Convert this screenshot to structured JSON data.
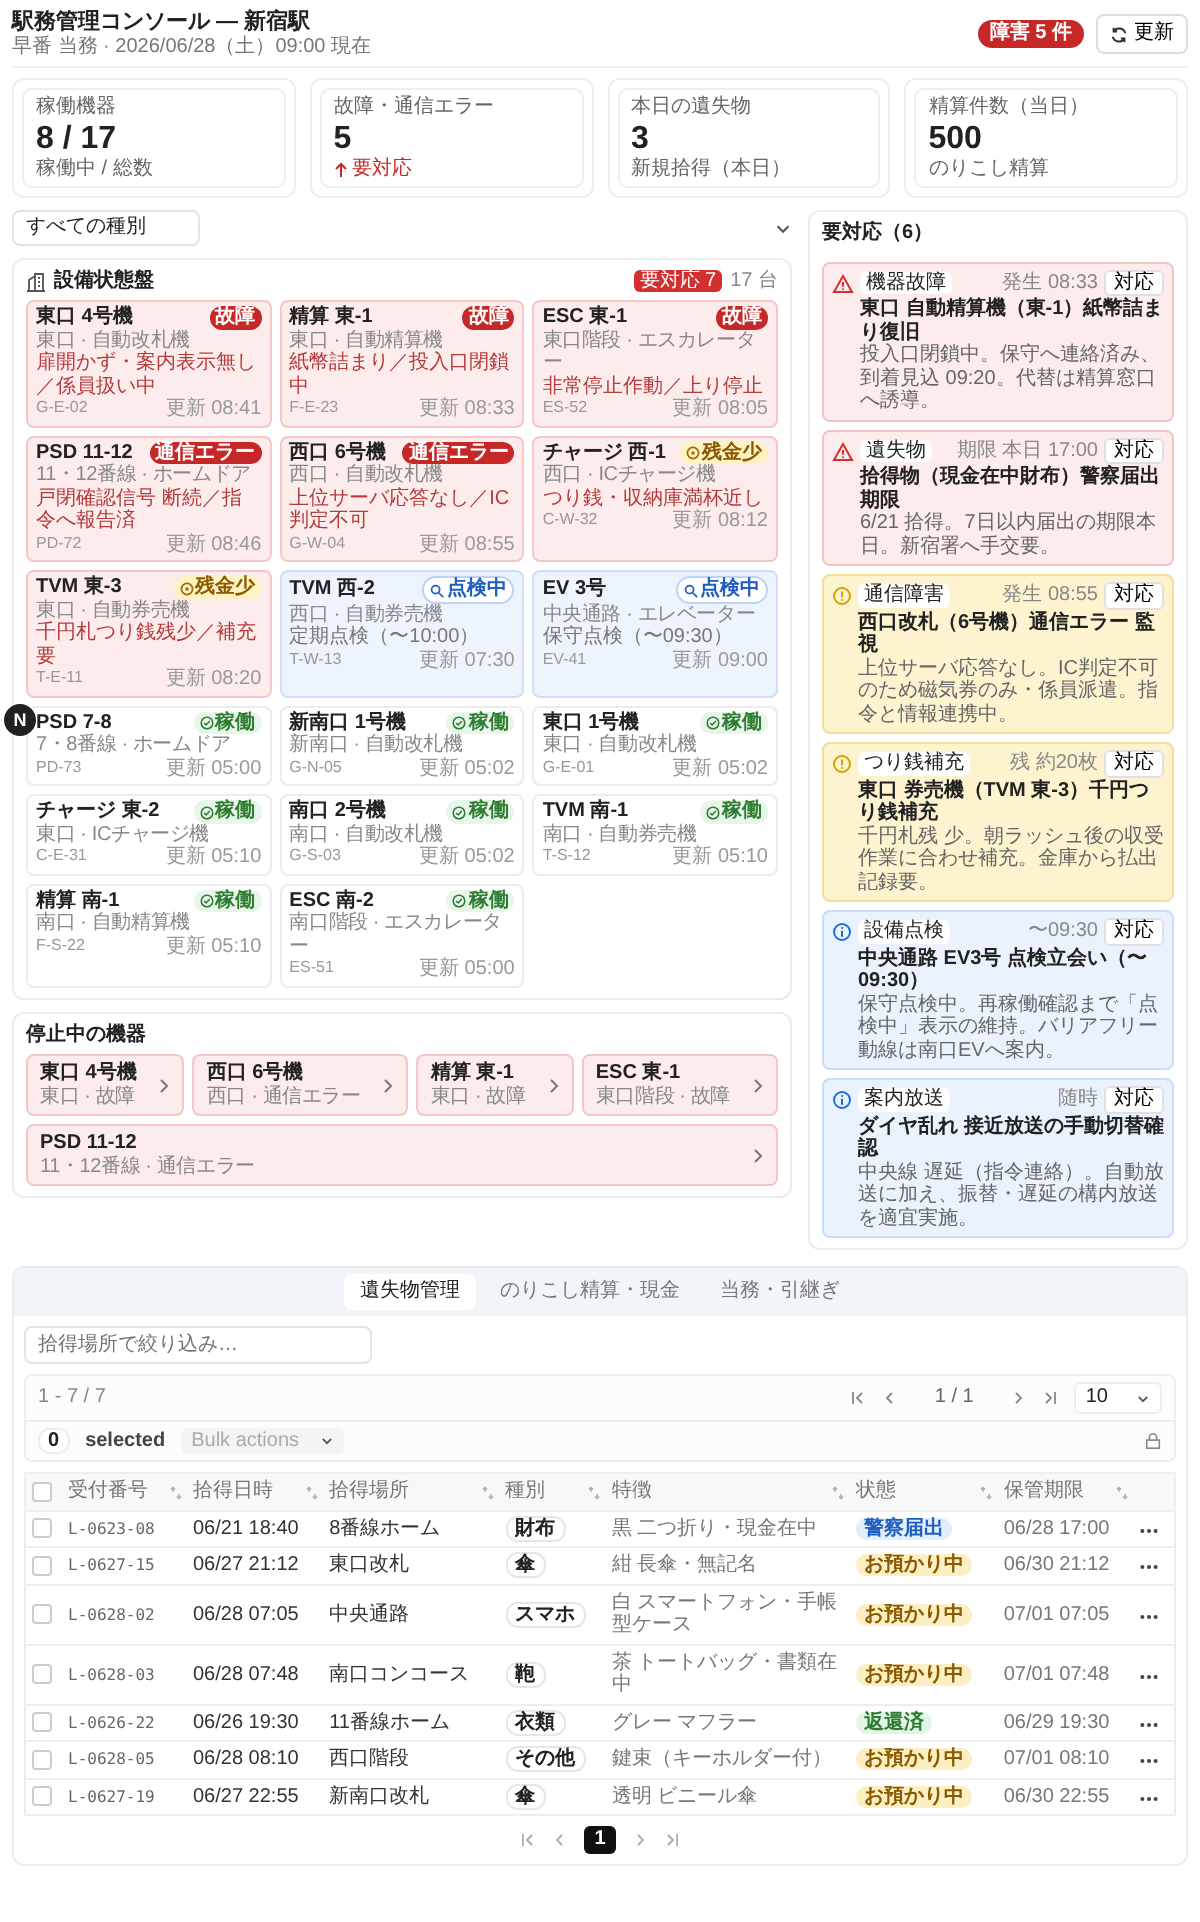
{
  "header": {
    "title": "駅務管理コンソール — 新宿駅",
    "subtitle": "早番 当務 · 2026/06/28（土）09:00 現在",
    "alert_badge": "障害 5 件",
    "refresh_label": "更新"
  },
  "stats": [
    {
      "label": "稼働機器",
      "value": "8 / 17",
      "note": "稼働中 / 総数",
      "alert": false
    },
    {
      "label": "故障・通信エラー",
      "value": "5",
      "note": "要対応",
      "alert": true
    },
    {
      "label": "本日の遺失物",
      "value": "3",
      "note": "新規拾得（本日）",
      "alert": false
    },
    {
      "label": "精算件数（当日）",
      "value": "500",
      "note": "のりこし精算",
      "alert": false
    }
  ],
  "filter": {
    "value": "すべての種別"
  },
  "device_panel": {
    "title": "設備状態盤",
    "badge": "要対応 7",
    "count": "17 台",
    "devices": [
      {
        "name": "東口 4号機",
        "location": "東口 · 自動改札機",
        "kind": "fault",
        "status": "故障",
        "note": "扉開かず・案内表示無し／係員扱い中",
        "code": "G-E-02",
        "updated": "更新 08:41"
      },
      {
        "name": "精算 東-1",
        "location": "東口 · 自動精算機",
        "kind": "fault",
        "status": "故障",
        "note": "紙幣詰まり／投入口閉鎖中",
        "code": "F-E-23",
        "updated": "更新 08:33"
      },
      {
        "name": "ESC 東-1",
        "location": "東口階段 · エスカレーター",
        "kind": "fault",
        "status": "故障",
        "note": "非常停止作動／上り停止",
        "code": "ES-52",
        "updated": "更新 08:05"
      },
      {
        "name": "PSD 11-12",
        "location": "11・12番線 · ホームドア",
        "kind": "comm",
        "status": "通信エラー",
        "note": "戸閉確認信号 断続／指令へ報告済",
        "code": "PD-72",
        "updated": "更新 08:46"
      },
      {
        "name": "西口 6号機",
        "location": "西口 · 自動改札機",
        "kind": "comm",
        "status": "通信エラー",
        "note": "上位サーバ応答なし／IC判定不可",
        "code": "G-W-04",
        "updated": "更新 08:55"
      },
      {
        "name": "チャージ 西-1",
        "location": "西口 · ICチャージ機",
        "kind": "low",
        "status": "残金少",
        "note": "つり銭・収納庫満杯近し",
        "code": "C-W-32",
        "updated": "更新 08:12"
      },
      {
        "name": "TVM 東-3",
        "location": "東口 · 自動券売機",
        "kind": "low",
        "status": "残金少",
        "note": "千円札つり銭残少／補充要",
        "code": "T-E-11",
        "updated": "更新 08:20"
      },
      {
        "name": "TVM 西-2",
        "location": "西口 · 自動券売機",
        "kind": "inspect",
        "status": "点検中",
        "note": "定期点検（〜10:00）",
        "code": "T-W-13",
        "updated": "更新 07:30"
      },
      {
        "name": "EV 3号",
        "location": "中央通路 · エレベーター",
        "kind": "inspect",
        "status": "点検中",
        "note": "保守点検（〜09:30）",
        "code": "EV-41",
        "updated": "更新 09:00"
      },
      {
        "name": "PSD 7-8",
        "location": "7・8番線 · ホームドア",
        "kind": "ok",
        "status": "稼働",
        "code": "PD-73",
        "updated": "更新 05:00"
      },
      {
        "name": "新南口 1号機",
        "location": "新南口 · 自動改札機",
        "kind": "ok",
        "status": "稼働",
        "code": "G-N-05",
        "updated": "更新 05:02"
      },
      {
        "name": "東口 1号機",
        "location": "東口 · 自動改札機",
        "kind": "ok",
        "status": "稼働",
        "code": "G-E-01",
        "updated": "更新 05:02"
      },
      {
        "name": "チャージ 東-2",
        "location": "東口 · ICチャージ機",
        "kind": "ok",
        "status": "稼働",
        "code": "C-E-31",
        "updated": "更新 05:10"
      },
      {
        "name": "南口 2号機",
        "location": "南口 · 自動改札機",
        "kind": "ok",
        "status": "稼働",
        "code": "G-S-03",
        "updated": "更新 05:02"
      },
      {
        "name": "TVM 南-1",
        "location": "南口 · 自動券売機",
        "kind": "ok",
        "status": "稼働",
        "code": "T-S-12",
        "updated": "更新 05:10"
      },
      {
        "name": "精算 南-1",
        "location": "南口 · 自動精算機",
        "kind": "ok",
        "status": "稼働",
        "code": "F-S-22",
        "updated": "更新 05:10"
      },
      {
        "name": "ESC 南-2",
        "location": "南口階段 · エスカレーター",
        "kind": "ok",
        "status": "稼働",
        "code": "ES-51",
        "updated": "更新 05:00"
      }
    ]
  },
  "alerts_panel": {
    "title": "要対応（6）",
    "alerts": [
      {
        "kind": "fault",
        "tag": "機器故障",
        "time": "発生 08:33",
        "title": "東口 自動精算機（東-1）紙幣詰まり復旧",
        "action": "対応",
        "desc": "投入口閉鎖中。保守へ連絡済み、到着見込 09:20。代替は精算窓口へ誘導。"
      },
      {
        "kind": "fault",
        "tag": "遺失物",
        "time": "期限 本日 17:00",
        "title": "拾得物（現金在中財布）警察届出期限",
        "action": "対応",
        "desc": "6/21 拾得。7日以内届出の期限本日。新宿署へ手交要。"
      },
      {
        "kind": "warn",
        "tag": "通信障害",
        "time": "発生 08:55",
        "title": "西口改札（6号機）通信エラー 監視",
        "action": "対応",
        "desc": "上位サーバ応答なし。IC判定不可のため磁気券のみ・係員派遣。指令と情報連携中。"
      },
      {
        "kind": "warn",
        "tag": "つり銭補充",
        "time": "残 約20枚",
        "title": "東口 券売機（TVM 東-3）千円つり銭補充",
        "action": "対応",
        "desc": "千円札残 少。朝ラッシュ後の収受作業に合わせ補充。金庫から払出記録要。"
      },
      {
        "kind": "info",
        "tag": "設備点検",
        "time": "〜09:30",
        "title": "中央通路 EV3号 点検立会い（〜09:30）",
        "action": "対応",
        "desc": "保守点検中。再稼働確認まで「点検中」表示の維持。バリアフリー動線は南口EVへ案内。"
      },
      {
        "kind": "info",
        "tag": "案内放送",
        "time": "随時",
        "title": "ダイヤ乱れ 接近放送の手動切替確認",
        "action": "対応",
        "desc": "中央線 遅延（指令連絡）。自動放送に加え、振替・遅延の構内放送を適宜実施。"
      }
    ]
  },
  "stopped_panel": {
    "title": "停止中の機器",
    "items": [
      {
        "name": "東口 4号機",
        "detail": "東口 · 故障"
      },
      {
        "name": "西口 6号機",
        "detail": "西口 · 通信エラー"
      },
      {
        "name": "精算 東-1",
        "detail": "東口 · 故障"
      },
      {
        "name": "ESC 東-1",
        "detail": "東口階段 · 故障"
      },
      {
        "name": "PSD 11-12",
        "detail": "11・12番線 · 通信エラー"
      }
    ]
  },
  "tabs": [
    {
      "label": "遺失物管理",
      "selected": true
    },
    {
      "label": "のりこし精算・現金",
      "selected": false
    },
    {
      "label": "当務・引継ぎ",
      "selected": false
    }
  ],
  "search": {
    "placeholder": "拾得場所で絞り込み…"
  },
  "pager": {
    "range": "1 - 7 / 7",
    "page": "1 / 1",
    "page_size": "10"
  },
  "bulk": {
    "count": "0",
    "label": "selected",
    "placeholder": "Bulk actions"
  },
  "table": {
    "select_all": {
      "checked": false
    },
    "columns": [
      "受付番号",
      "拾得日時",
      "拾得場所",
      "種別",
      "特徴",
      "状態",
      "保管期限"
    ],
    "rows": [
      {
        "checked": false,
        "id": "L-0623-08",
        "date": "06/21 18:40",
        "place": "8番線ホーム",
        "type": "財布",
        "feature": "黒 二つ折り・現金在中",
        "status": "警察届出",
        "kind": "police",
        "due": "06/28 17:00"
      },
      {
        "checked": false,
        "id": "L-0627-15",
        "date": "06/27 21:12",
        "place": "東口改札",
        "type": "傘",
        "feature": "紺 長傘・無記名",
        "status": "お預かり中",
        "kind": "holding",
        "due": "06/30 21:12"
      },
      {
        "checked": false,
        "id": "L-0628-02",
        "date": "06/28 07:05",
        "place": "中央通路",
        "type": "スマホ",
        "feature": "白 スマートフォン・手帳型ケース",
        "status": "お預かり中",
        "kind": "holding",
        "due": "07/01 07:05"
      },
      {
        "checked": false,
        "id": "L-0628-03",
        "date": "06/28 07:48",
        "place": "南口コンコース",
        "type": "鞄",
        "feature": "茶 トートバッグ・書類在中",
        "status": "お預かり中",
        "kind": "holding",
        "due": "07/01 07:48"
      },
      {
        "checked": false,
        "id": "L-0626-22",
        "date": "06/26 19:30",
        "place": "11番線ホーム",
        "type": "衣類",
        "feature": "グレー マフラー",
        "status": "返還済",
        "kind": "returned",
        "due": "06/29 19:30"
      },
      {
        "checked": false,
        "id": "L-0628-05",
        "date": "06/28 08:10",
        "place": "西口階段",
        "type": "その他",
        "feature": "鍵束（キーホルダー付）",
        "status": "お預かり中",
        "kind": "holding",
        "due": "07/01 08:10"
      },
      {
        "checked": false,
        "id": "L-0627-19",
        "date": "06/27 22:55",
        "place": "新南口改札",
        "type": "傘",
        "feature": "透明 ビニール傘",
        "status": "お預かり中",
        "kind": "holding",
        "due": "06/30 22:55"
      }
    ]
  },
  "pagination": {
    "pages": [
      {
        "label": "1",
        "selected": true
      }
    ]
  },
  "dev_badge": "N"
}
